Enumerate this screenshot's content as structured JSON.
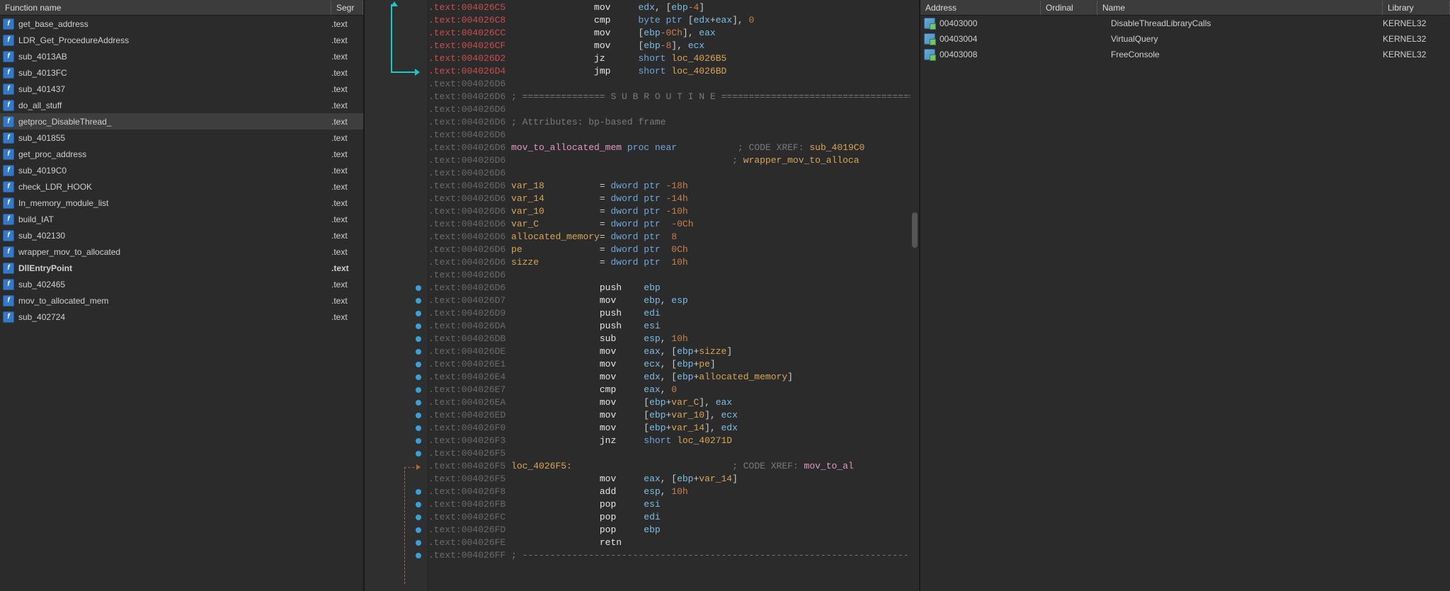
{
  "left": {
    "header": {
      "func": "Function name",
      "seg": "Segr"
    },
    "rows": [
      {
        "name": "get_base_address",
        "seg": ".text",
        "bold": false,
        "selected": false
      },
      {
        "name": "LDR_Get_ProcedureAddress",
        "seg": ".text",
        "bold": false,
        "selected": false
      },
      {
        "name": "sub_4013AB",
        "seg": ".text",
        "bold": false,
        "selected": false
      },
      {
        "name": "sub_4013FC",
        "seg": ".text",
        "bold": false,
        "selected": false
      },
      {
        "name": "sub_401437",
        "seg": ".text",
        "bold": false,
        "selected": false
      },
      {
        "name": "do_all_stuff",
        "seg": ".text",
        "bold": false,
        "selected": false
      },
      {
        "name": "getproc_DisableThread_",
        "seg": ".text",
        "bold": false,
        "selected": true
      },
      {
        "name": "sub_401855",
        "seg": ".text",
        "bold": false,
        "selected": false
      },
      {
        "name": "get_proc_address",
        "seg": ".text",
        "bold": false,
        "selected": false
      },
      {
        "name": "sub_4019C0",
        "seg": ".text",
        "bold": false,
        "selected": false
      },
      {
        "name": "check_LDR_HOOK",
        "seg": ".text",
        "bold": false,
        "selected": false
      },
      {
        "name": "In_memory_module_list",
        "seg": ".text",
        "bold": false,
        "selected": false
      },
      {
        "name": "build_IAT",
        "seg": ".text",
        "bold": false,
        "selected": false
      },
      {
        "name": "sub_402130",
        "seg": ".text",
        "bold": false,
        "selected": false
      },
      {
        "name": "wrapper_mov_to_allocated",
        "seg": ".text",
        "bold": false,
        "selected": false
      },
      {
        "name": "DllEntryPoint",
        "seg": ".text",
        "bold": true,
        "selected": false
      },
      {
        "name": "sub_402465",
        "seg": ".text",
        "bold": false,
        "selected": false
      },
      {
        "name": "mov_to_allocated_mem",
        "seg": ".text",
        "bold": false,
        "selected": false
      },
      {
        "name": "sub_402724",
        "seg": ".text",
        "bold": false,
        "selected": false
      }
    ]
  },
  "right": {
    "header": {
      "addr": "Address",
      "ord": "Ordinal",
      "name": "Name",
      "lib": "Library"
    },
    "rows": [
      {
        "addr": "00403000",
        "name": "DisableThreadLibraryCalls",
        "lib": "KERNEL32"
      },
      {
        "addr": "00403004",
        "name": "VirtualQuery",
        "lib": "KERNEL32"
      },
      {
        "addr": "00403008",
        "name": "FreeConsole",
        "lib": "KERNEL32"
      }
    ]
  },
  "code": {
    "dot_lines": [
      23,
      24,
      25,
      26,
      27,
      28,
      29,
      30,
      31,
      32,
      33,
      34,
      35,
      36,
      39,
      40,
      41,
      42,
      43,
      44
    ],
    "lines": [
      {
        "addr": ".text:004026C5",
        "addr_class": "addr-red",
        "rest_html": "                <span class='mnem'>mov</span>     <span class='reg'>edx</span>, [<span class='reg'>ebp</span><span class='num'>-4</span>]"
      },
      {
        "addr": ".text:004026C8",
        "addr_class": "addr-red",
        "rest_html": "                <span class='mnem'>cmp</span>     <span class='kw'>byte ptr</span> [<span class='reg'>edx</span>+<span class='reg'>eax</span>], <span class='num'>0</span>"
      },
      {
        "addr": ".text:004026CC",
        "addr_class": "addr-red",
        "rest_html": "                <span class='mnem'>mov</span>     [<span class='reg'>ebp</span><span class='num'>-0Ch</span>], <span class='reg'>eax</span>"
      },
      {
        "addr": ".text:004026CF",
        "addr_class": "addr-red",
        "rest_html": "                <span class='mnem'>mov</span>     [<span class='reg'>ebp</span><span class='num'>-8</span>], <span class='reg'>ecx</span>"
      },
      {
        "addr": ".text:004026D2",
        "addr_class": "addr-red",
        "rest_html": "                <span class='mnem'>jz</span>      <span class='kw'>short</span> <span class='id'>loc_4026B5</span>"
      },
      {
        "addr": ".text:004026D4",
        "addr_class": "addr-red",
        "rest_html": "                <span class='mnem'>jmp</span>     <span class='kw'>short</span> <span class='id'>loc_4026BD</span>"
      },
      {
        "addr": ".text:004026D6",
        "addr_class": "addr-dim",
        "rest_html": ""
      },
      {
        "addr": ".text:004026D6",
        "addr_class": "addr-dim",
        "rest_html": " <span class='comment'>; =============== S U B R O U T I N E =======================================</span>"
      },
      {
        "addr": ".text:004026D6",
        "addr_class": "addr-dim",
        "rest_html": ""
      },
      {
        "addr": ".text:004026D6",
        "addr_class": "addr-dim",
        "rest_html": " <span class='comment'>; Attributes: bp-based frame</span>"
      },
      {
        "addr": ".text:004026D6",
        "addr_class": "addr-dim",
        "rest_html": ""
      },
      {
        "addr": ".text:004026D6",
        "addr_class": "addr-dim",
        "rest_html": " <span class='id-pink'>mov_to_allocated_mem</span> <span class='kw'>proc near</span>           <span class='xref'>; CODE XREF: </span><span class='xref-link'>sub_4019C0</span>"
      },
      {
        "addr": ".text:004026D6",
        "addr_class": "addr-dim",
        "rest_html": "                                         <span class='xref'>; </span><span class='xref-link'>wrapper_mov_to_alloca</span>"
      },
      {
        "addr": ".text:004026D6",
        "addr_class": "addr-dim",
        "rest_html": ""
      },
      {
        "addr": ".text:004026D6",
        "addr_class": "addr-dim",
        "rest_html": " <span class='id'>var_18</span>          = <span class='kw'>dword ptr</span> <span class='num'>-18h</span>"
      },
      {
        "addr": ".text:004026D6",
        "addr_class": "addr-dim",
        "rest_html": " <span class='id'>var_14</span>          = <span class='kw'>dword ptr</span> <span class='num'>-14h</span>"
      },
      {
        "addr": ".text:004026D6",
        "addr_class": "addr-dim",
        "rest_html": " <span class='id'>var_10</span>          = <span class='kw'>dword ptr</span> <span class='num'>-10h</span>"
      },
      {
        "addr": ".text:004026D6",
        "addr_class": "addr-dim",
        "rest_html": " <span class='id'>var_C</span>           = <span class='kw'>dword ptr</span>  <span class='num'>-0Ch</span>"
      },
      {
        "addr": ".text:004026D6",
        "addr_class": "addr-dim",
        "rest_html": " <span class='id'>allocated_memory</span>= <span class='kw'>dword ptr</span>  <span class='num'>8</span>"
      },
      {
        "addr": ".text:004026D6",
        "addr_class": "addr-dim",
        "rest_html": " <span class='id'>pe</span>              = <span class='kw'>dword ptr</span>  <span class='num'>0Ch</span>"
      },
      {
        "addr": ".text:004026D6",
        "addr_class": "addr-dim",
        "rest_html": " <span class='id'>sizze</span>           = <span class='kw'>dword ptr</span>  <span class='num'>10h</span>"
      },
      {
        "addr": ".text:004026D6",
        "addr_class": "addr-dim",
        "rest_html": ""
      },
      {
        "addr": ".text:004026D6",
        "addr_class": "addr-dim",
        "rest_html": "                 <span class='mnem'>push</span>    <span class='reg'>ebp</span>"
      },
      {
        "addr": ".text:004026D7",
        "addr_class": "addr-dim",
        "rest_html": "                 <span class='mnem'>mov</span>     <span class='reg'>ebp</span>, <span class='reg'>esp</span>"
      },
      {
        "addr": ".text:004026D9",
        "addr_class": "addr-dim",
        "rest_html": "                 <span class='mnem'>push</span>    <span class='reg'>edi</span>"
      },
      {
        "addr": ".text:004026DA",
        "addr_class": "addr-dim",
        "rest_html": "                 <span class='mnem'>push</span>    <span class='reg'>esi</span>"
      },
      {
        "addr": ".text:004026DB",
        "addr_class": "addr-dim",
        "rest_html": "                 <span class='mnem'>sub</span>     <span class='reg'>esp</span>, <span class='num'>10h</span>"
      },
      {
        "addr": ".text:004026DE",
        "addr_class": "addr-dim",
        "rest_html": "                 <span class='mnem'>mov</span>     <span class='reg'>eax</span>, [<span class='reg'>ebp</span>+<span class='id'>sizze</span>]"
      },
      {
        "addr": ".text:004026E1",
        "addr_class": "addr-dim",
        "rest_html": "                 <span class='mnem'>mov</span>     <span class='reg'>ecx</span>, [<span class='reg'>ebp</span>+<span class='id'>pe</span>]"
      },
      {
        "addr": ".text:004026E4",
        "addr_class": "addr-dim",
        "rest_html": "                 <span class='mnem'>mov</span>     <span class='reg'>edx</span>, [<span class='reg'>ebp</span>+<span class='id'>allocated_memory</span>]"
      },
      {
        "addr": ".text:004026E7",
        "addr_class": "addr-dim",
        "rest_html": "                 <span class='mnem'>cmp</span>     <span class='reg'>eax</span>, <span class='num'>0</span>"
      },
      {
        "addr": ".text:004026EA",
        "addr_class": "addr-dim",
        "rest_html": "                 <span class='mnem'>mov</span>     [<span class='reg'>ebp</span>+<span class='id'>var_C</span>], <span class='reg'>eax</span>"
      },
      {
        "addr": ".text:004026ED",
        "addr_class": "addr-dim",
        "rest_html": "                 <span class='mnem'>mov</span>     [<span class='reg'>ebp</span>+<span class='id'>var_10</span>], <span class='reg'>ecx</span>"
      },
      {
        "addr": ".text:004026F0",
        "addr_class": "addr-dim",
        "rest_html": "                 <span class='mnem'>mov</span>     [<span class='reg'>ebp</span>+<span class='id'>var_14</span>], <span class='reg'>edx</span>"
      },
      {
        "addr": ".text:004026F3",
        "addr_class": "addr-dim",
        "rest_html": "                 <span class='mnem'>jnz</span>     <span class='kw'>short</span> <span class='id'>loc_40271D</span>"
      },
      {
        "addr": ".text:004026F5",
        "addr_class": "addr-dim",
        "rest_html": ""
      },
      {
        "addr": ".text:004026F5",
        "addr_class": "addr-dim",
        "rest_html": " <span class='label'>loc_4026F5:</span>                             <span class='xref'>; CODE XREF: </span><span class='id-pink'>mov_to_al</span>"
      },
      {
        "addr": ".text:004026F5",
        "addr_class": "addr-dim",
        "rest_html": "                 <span class='mnem'>mov</span>     <span class='reg'>eax</span>, [<span class='reg'>ebp</span>+<span class='id'>var_14</span>]"
      },
      {
        "addr": ".text:004026F8",
        "addr_class": "addr-dim",
        "rest_html": "                 <span class='mnem'>add</span>     <span class='reg'>esp</span>, <span class='num'>10h</span>"
      },
      {
        "addr": ".text:004026FB",
        "addr_class": "addr-dim",
        "rest_html": "                 <span class='mnem'>pop</span>     <span class='reg'>esi</span>"
      },
      {
        "addr": ".text:004026FC",
        "addr_class": "addr-dim",
        "rest_html": "                 <span class='mnem'>pop</span>     <span class='reg'>edi</span>"
      },
      {
        "addr": ".text:004026FD",
        "addr_class": "addr-dim",
        "rest_html": "                 <span class='mnem'>pop</span>     <span class='reg'>ebp</span>"
      },
      {
        "addr": ".text:004026FE",
        "addr_class": "addr-dim",
        "rest_html": "                 <span class='mnem'>retn</span>"
      },
      {
        "addr": ".text:004026FF",
        "addr_class": "addr-dim",
        "rest_html": " <span class='comment'>; ---------------------------------------------------------------------------</span>"
      }
    ]
  }
}
